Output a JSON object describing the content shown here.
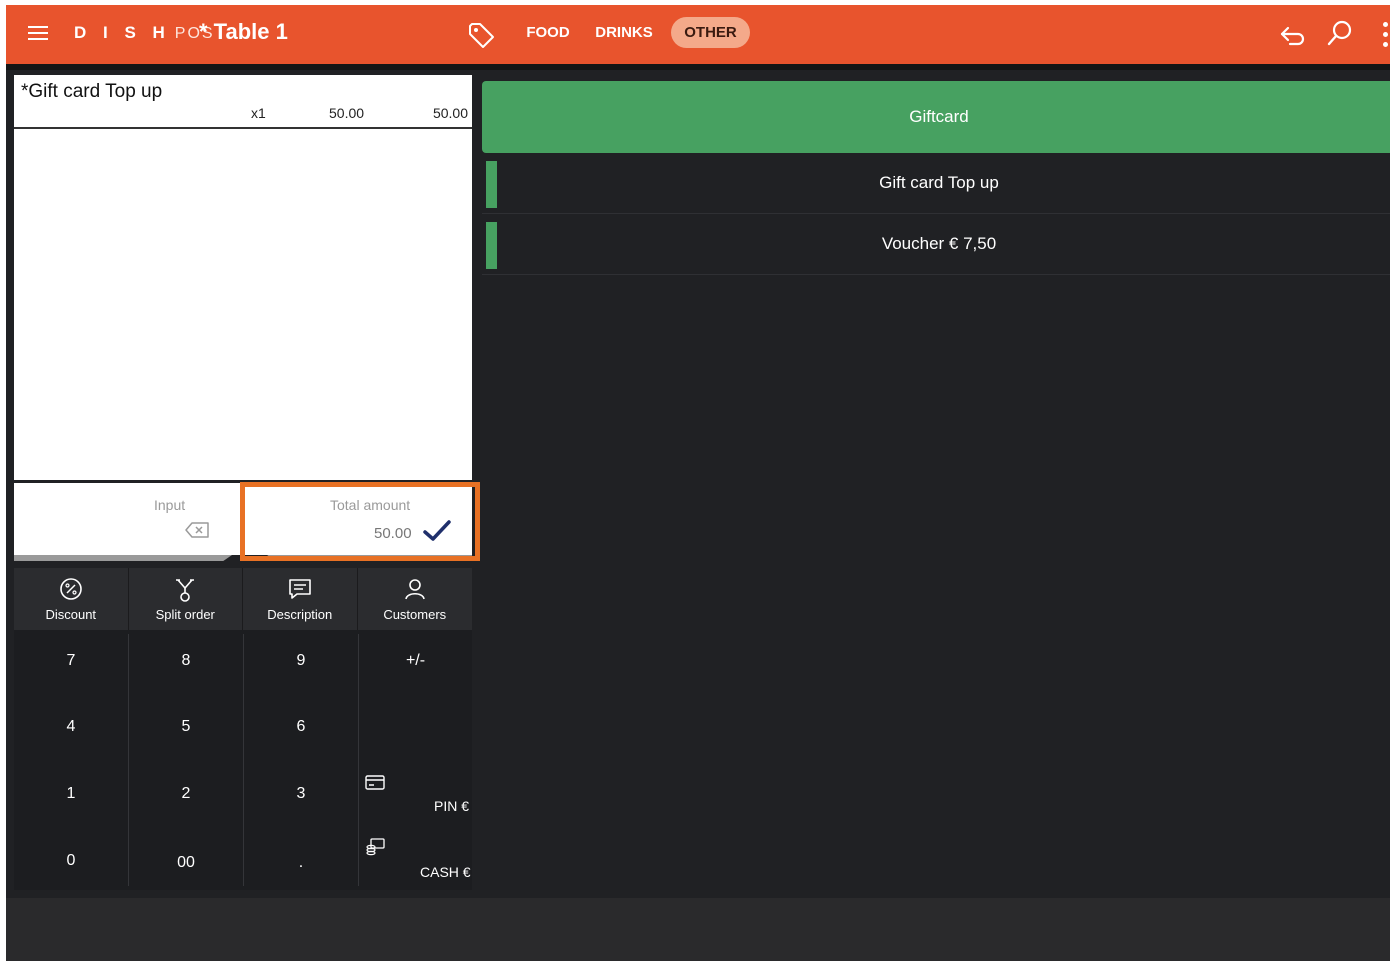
{
  "header": {
    "brand_bold": "D I S H",
    "brand_light": "POS",
    "table_title": "* Table 1",
    "categories": [
      {
        "label": "FOOD",
        "active": false
      },
      {
        "label": "DRINKS",
        "active": false
      },
      {
        "label": "OTHER",
        "active": true
      }
    ],
    "accent_color": "#e8542d"
  },
  "order": {
    "items": [
      {
        "name": "*Gift card Top up",
        "qty": "x1",
        "unit_price": "50.00",
        "total": "50.00"
      }
    ]
  },
  "calculator": {
    "input_label": "Input",
    "total_label": "Total amount",
    "total_value": "50.00"
  },
  "actions": [
    {
      "label": "Discount",
      "icon": "discount-icon"
    },
    {
      "label": "Split order",
      "icon": "split-icon"
    },
    {
      "label": "Description",
      "icon": "description-icon"
    },
    {
      "label": "Customers",
      "icon": "customers-icon"
    }
  ],
  "keypad": {
    "keys": [
      "7",
      "8",
      "9",
      "+/-",
      "4",
      "5",
      "6",
      "1",
      "2",
      "3",
      "0",
      "00",
      "."
    ],
    "pin_label": "PIN €",
    "cash_label": "CASH €"
  },
  "products": {
    "group_tile": "Giftcard",
    "items": [
      "Gift card Top up",
      "Voucher € 7,50"
    ],
    "tile_color": "#47a161"
  }
}
